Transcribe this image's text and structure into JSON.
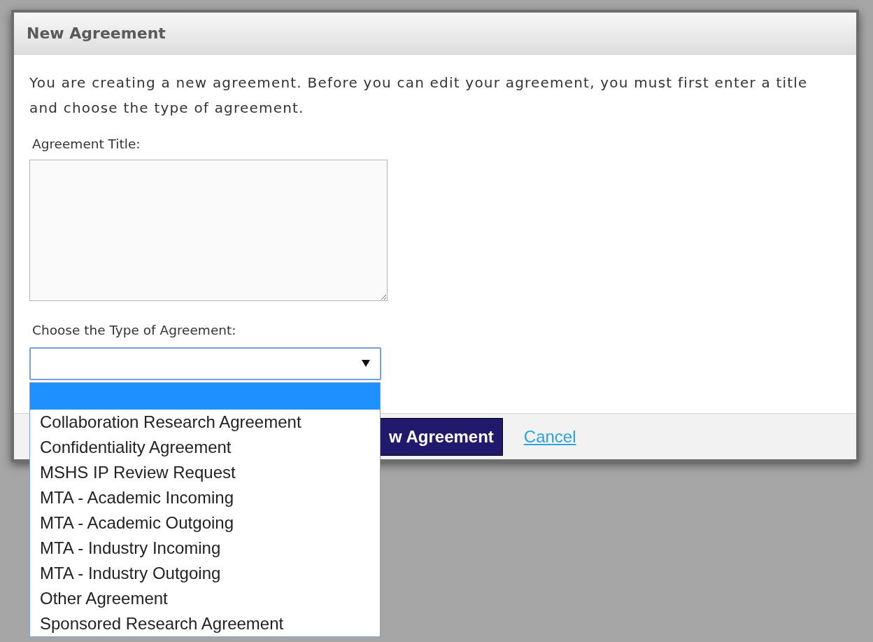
{
  "dialog": {
    "title": "New Agreement",
    "intro": "You are creating a new agreement. Before you can edit your agreement, you must first enter a title and choose the type of agreement.",
    "title_label": "Agreement Title:",
    "type_label": "Choose the Type of Agreement:",
    "type_select": {
      "expanded": true,
      "options": [
        {
          "selected": true
        },
        {
          "label": "Collaboration Research Agreement",
          "selected": false
        },
        {
          "label": "Confidentiality Agreement",
          "selected": false
        },
        {
          "label": "MSHS IP Review Request",
          "selected": false
        },
        {
          "label": "MTA - Academic Incoming",
          "selected": false
        },
        {
          "label": "MTA - Academic Outgoing",
          "selected": false
        },
        {
          "label": "MTA - Industry Incoming",
          "selected": false
        },
        {
          "label": "MTA - Industry Outgoing",
          "selected": false
        },
        {
          "label": "Other Agreement",
          "selected": false
        },
        {
          "label": "Sponsored Research Agreement",
          "selected": false
        }
      ]
    },
    "buttons": [
      {
        "kind": "primary",
        "label": "w Agreement"
      },
      {
        "kind": "link",
        "label": "Cancel"
      }
    ]
  }
}
